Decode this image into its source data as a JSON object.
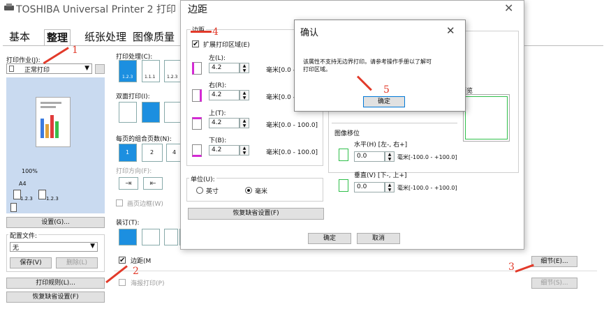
{
  "main_window": {
    "title": "TOSHIBA Universal Printer 2 打印",
    "tabs": [
      "基本",
      "整理",
      "纸张处理",
      "图像质量"
    ],
    "print_job_label": "打印作业(J):",
    "print_job_value": "正常打印",
    "preview_zoom": "100%",
    "preview_paper": "A4",
    "collate_labels": [
      "1.2.3",
      "1.2.3"
    ],
    "settings_button": "设置(G)...",
    "profile_label": "配置文件:",
    "profile_value": "无",
    "save_button": "保存(V)",
    "delete_button": "删除(L)",
    "print_rules_button": "打印规则(L)...",
    "restore_defaults_button": "恢复缺省设置(F)",
    "print_process_label": "打印处理(C):",
    "print_process_items": [
      "1.2.3",
      "1.1.1",
      "1.2.3"
    ],
    "duplex_label": "双面打印(I):",
    "pages_per_sheet_label": "每页的组合页数(N):",
    "pages_per_sheet_items": [
      "1",
      "2",
      "4"
    ],
    "print_direction_label": "打印方向(F):",
    "page_border_label": "画页边框(W)",
    "binding_label": "装订(T):",
    "margin_checkbox_label": "边距(M",
    "poster_checkbox_label": "海报打印(P)",
    "details_button_1": "细节(E)...",
    "details_button_2": "细节(S)..."
  },
  "margin_dialog": {
    "title": "边距",
    "group_label": "边距",
    "expand_area_label": "扩展打印区域(E)",
    "left_label": "左(L):",
    "left_value": "4.2",
    "right_label": "右(R):",
    "right_value": "4.2",
    "top_label": "上(T):",
    "top_value": "4.2",
    "bottom_label": "下(B):",
    "bottom_value": "4.2",
    "unit_short": "毫米[0.0 -",
    "unit_full": "毫米[0.0 - 100.0]",
    "units_label": "单位(U):",
    "inch_label": "英寸",
    "mm_label": "毫米",
    "restore_button": "恢复缺省设置(F)",
    "preview_label": "预览",
    "image_shift_label": "图像移位",
    "horizontal_label": "水平(H) [左-, 右+]",
    "horizontal_value": "0.0",
    "vertical_label": "垂直(V) [下-, 上+]",
    "vertical_value": "0.0",
    "shift_unit": "毫米[-100.0 - +100.0]",
    "ok_button": "确定",
    "cancel_button": "取消"
  },
  "confirm_dialog": {
    "title": "确认",
    "message_line1": "该属性不支持无边界打印。请参考操作手册以了解可",
    "message_line2": "打印区域。",
    "ok_button": "确定"
  },
  "annotations": [
    "1",
    "2",
    "3",
    "4",
    "5"
  ],
  "colors": {
    "accent_blue": "#1c8fe0",
    "annotation_red": "#e23a2a",
    "preview_green": "#2fbf4a"
  }
}
